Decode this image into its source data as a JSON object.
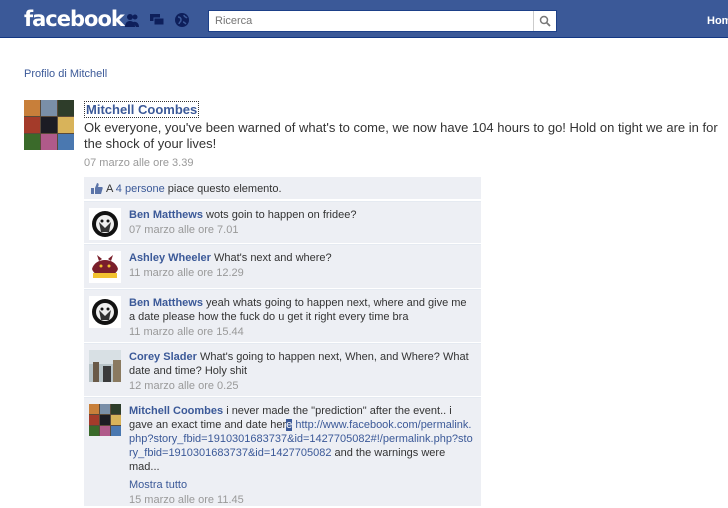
{
  "header": {
    "logo": "facebook",
    "search_placeholder": "Ricerca",
    "home_label": "Hom"
  },
  "breadcrumb": "Profilo di Mitchell",
  "post": {
    "author": "Mitchell Coombes",
    "text": "Ok everyone, you've been warned of what's to come, we now have 104 hours to go! Hold on tight we are in for the shock of your lives!",
    "time": "07 marzo alle ore 3.39"
  },
  "likes": {
    "prefix": "A ",
    "count_link": "4 persone",
    "suffix": " piace questo elemento."
  },
  "comments": [
    {
      "name": "Ben Matthews",
      "text": "wots goin to happen on fridee?",
      "time": "07 marzo alle ore 7.01"
    },
    {
      "name": "Ashley Wheeler",
      "text": "What's next and where?",
      "time": "11 marzo alle ore 12.29"
    },
    {
      "name": "Ben Matthews",
      "text": "yeah whats going to happen next, where and give me a date please how the fuck do u get it right every time bra",
      "time": "11 marzo alle ore 15.44"
    },
    {
      "name": "Corey Slader",
      "text": "What's going to happen next, When, and Where? What date and time? Holy shit",
      "time": "12 marzo alle ore 0.25"
    },
    {
      "name": "Mitchell Coombes",
      "text_before": "i never made the \"prediction\" after the event.. i gave an exact time and date her",
      "text_sel": "e",
      "link": "http://www.facebook.com/permalink.php?story_fbid=1910301683737&id=1427705082#!/permalink.php?story_fbid=1910301683737&id=1427705082",
      "text_after": " and the warnings were mad...",
      "more": "Mostra tutto",
      "time": "15 marzo alle ore 11.45"
    }
  ]
}
